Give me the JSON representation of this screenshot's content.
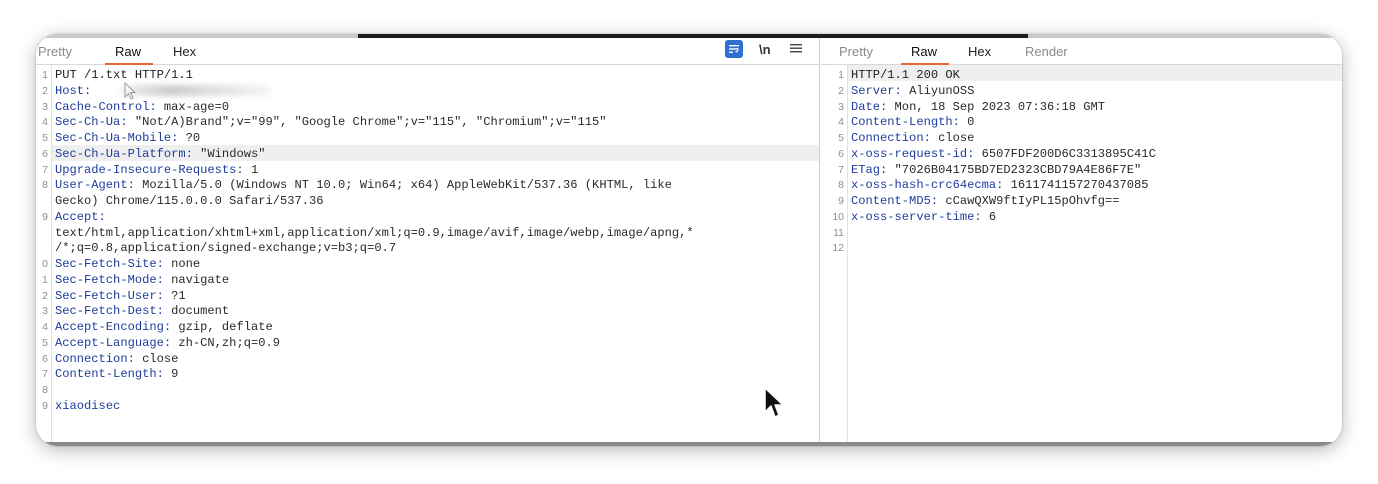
{
  "request": {
    "tabs": [
      {
        "label": "Pretty"
      },
      {
        "label": "Raw"
      },
      {
        "label": "Hex"
      }
    ],
    "controls": {
      "newline_label": "\\n",
      "menu_icon": "hamburger-icon",
      "wrap_icon": "word-wrap-icon"
    },
    "lines": [
      {
        "num": "1",
        "key": "PUT /1.txt HTTP/1.1",
        "value": ""
      },
      {
        "num": "2",
        "key": "Host:",
        "value": ""
      },
      {
        "num": "3",
        "key": "Cache-Control:",
        "value": " max-age=0"
      },
      {
        "num": "4",
        "key": "Sec-Ch-Ua:",
        "value": " \"Not/A)Brand\";v=\"99\", \"Google Chrome\";v=\"115\", \"Chromium\";v=\"115\""
      },
      {
        "num": "5",
        "key": "Sec-Ch-Ua-Mobile:",
        "value": " ?0"
      },
      {
        "num": "6",
        "key": "Sec-Ch-Ua-Platform:",
        "value": " \"Windows\""
      },
      {
        "num": "7",
        "key": "Upgrade-Insecure-Requests:",
        "value": " 1"
      },
      {
        "num": "8",
        "key": "User-Agent:",
        "value": " Mozilla/5.0 (Windows NT 10.0; Win64; x64) AppleWebKit/537.36 (KHTML, like"
      },
      {
        "num": "",
        "key": "",
        "value": "Gecko) Chrome/115.0.0.0 Safari/537.36"
      },
      {
        "num": "9",
        "key": "Accept:",
        "value": ""
      },
      {
        "num": "",
        "key": "",
        "value": "text/html,application/xhtml+xml,application/xml;q=0.9,image/avif,image/webp,image/apng,*"
      },
      {
        "num": "",
        "key": "",
        "value": "/*;q=0.8,application/signed-exchange;v=b3;q=0.7"
      },
      {
        "num": "0",
        "key": "Sec-Fetch-Site:",
        "value": " none"
      },
      {
        "num": "1",
        "key": "Sec-Fetch-Mode:",
        "value": " navigate"
      },
      {
        "num": "2",
        "key": "Sec-Fetch-User:",
        "value": " ?1"
      },
      {
        "num": "3",
        "key": "Sec-Fetch-Dest:",
        "value": " document"
      },
      {
        "num": "4",
        "key": "Accept-Encoding:",
        "value": " gzip, deflate"
      },
      {
        "num": "5",
        "key": "Accept-Language:",
        "value": " zh-CN,zh;q=0.9"
      },
      {
        "num": "6",
        "key": "Connection:",
        "value": " close"
      },
      {
        "num": "7",
        "key": "Content-Length:",
        "value": " 9"
      },
      {
        "num": "8",
        "key": "",
        "value": ""
      },
      {
        "num": "9",
        "key": "xiaodisec",
        "value": ""
      }
    ]
  },
  "response": {
    "tabs": [
      {
        "label": "Pretty"
      },
      {
        "label": "Raw"
      },
      {
        "label": "Hex"
      },
      {
        "label": "Render"
      }
    ],
    "lines": [
      {
        "num": "1",
        "key": "HTTP/1.1 200 OK",
        "value": ""
      },
      {
        "num": "2",
        "key": "Server:",
        "value": " AliyunOSS"
      },
      {
        "num": "3",
        "key": "Date:",
        "value": " Mon, 18 Sep 2023 07:36:18 GMT"
      },
      {
        "num": "4",
        "key": "Content-Length:",
        "value": " 0"
      },
      {
        "num": "5",
        "key": "Connection:",
        "value": " close"
      },
      {
        "num": "6",
        "key": "x-oss-request-id:",
        "value": " 6507FDF200D6C3313895C41C"
      },
      {
        "num": "7",
        "key": "ETag:",
        "value": " \"7026B04175BD7ED2323CBD79A4E86F7E\""
      },
      {
        "num": "8",
        "key": "x-oss-hash-crc64ecma:",
        "value": " 1611741157270437085"
      },
      {
        "num": "9",
        "key": "Content-MD5:",
        "value": " cCawQXW9ftIyPL15pOhvfg=="
      },
      {
        "num": "10",
        "key": "x-oss-server-time:",
        "value": " 6"
      },
      {
        "num": "11",
        "key": "",
        "value": ""
      },
      {
        "num": "12",
        "key": "",
        "value": ""
      }
    ]
  }
}
